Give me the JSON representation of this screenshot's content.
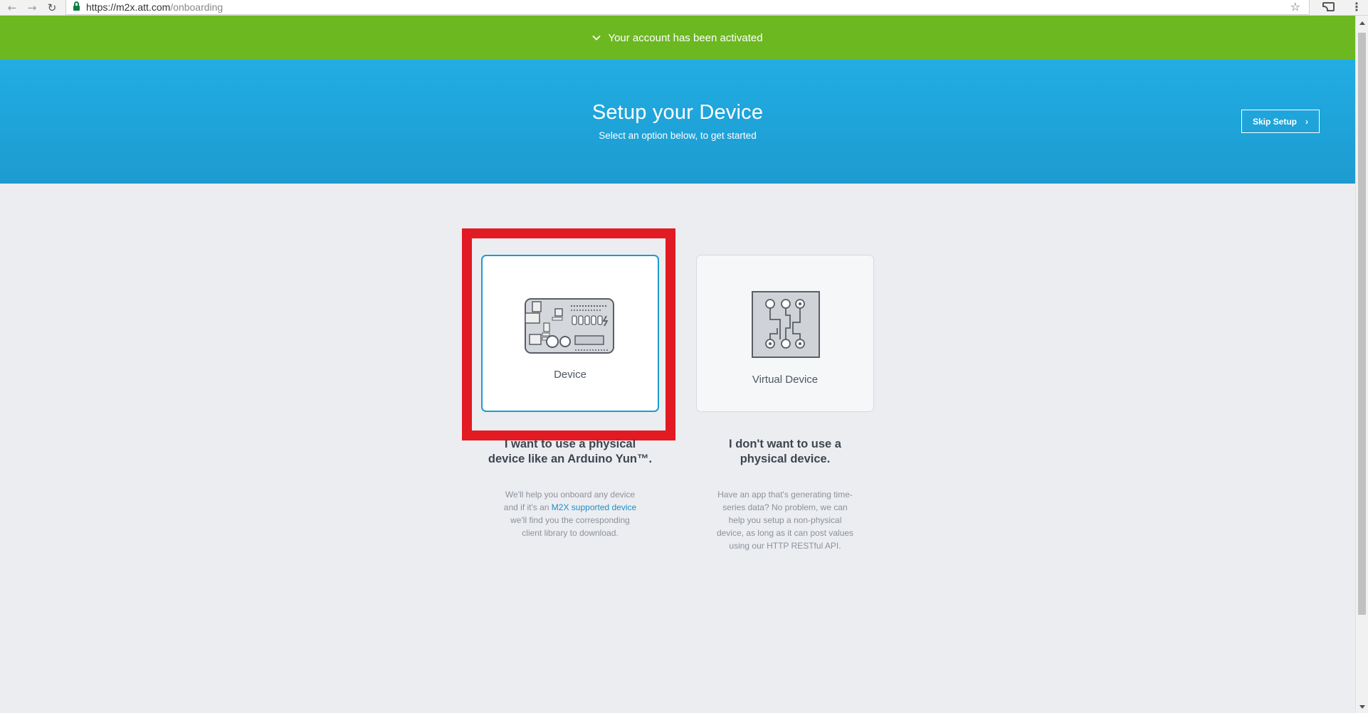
{
  "browser": {
    "url_host": "https://m2x.att.com",
    "url_path": "/onboarding"
  },
  "banner": {
    "message": "Your account has been activated",
    "icon": "check-icon"
  },
  "hero": {
    "title": "Setup your Device",
    "subtitle": "Select an option below, to get started",
    "skip_label": "Skip Setup",
    "skip_icon": "chevron-right-icon"
  },
  "options": {
    "device": {
      "card_label": "Device",
      "heading_line1": "I want to use a physical",
      "heading_line2": "device like an Arduino Yun™.",
      "body_line1": "We'll help you onboard any device",
      "body_line2_prefix": "and if it's an ",
      "body_link": "M2X supported device",
      "body_line3": "we'll find you the corresponding",
      "body_line4": "client library to download.",
      "icon": "circuit-board-icon",
      "selected": true
    },
    "virtual": {
      "card_label": "Virtual Device",
      "heading_line1": "I don't want to use a",
      "heading_line2": "physical device.",
      "body_line1": "Have an app that's generating time-",
      "body_line2": "series data? No problem, we can",
      "body_line3": "help you setup a non-physical",
      "body_line4": "device, as long as it can post values",
      "body_line5": "using our HTTP RESTful API.",
      "icon": "virtual-chip-icon"
    }
  },
  "colors": {
    "banner_green": "#6cb821",
    "hero_blue": "#21ade3",
    "highlight_red": "#e21a23",
    "link_blue": "#1d8fc5"
  }
}
